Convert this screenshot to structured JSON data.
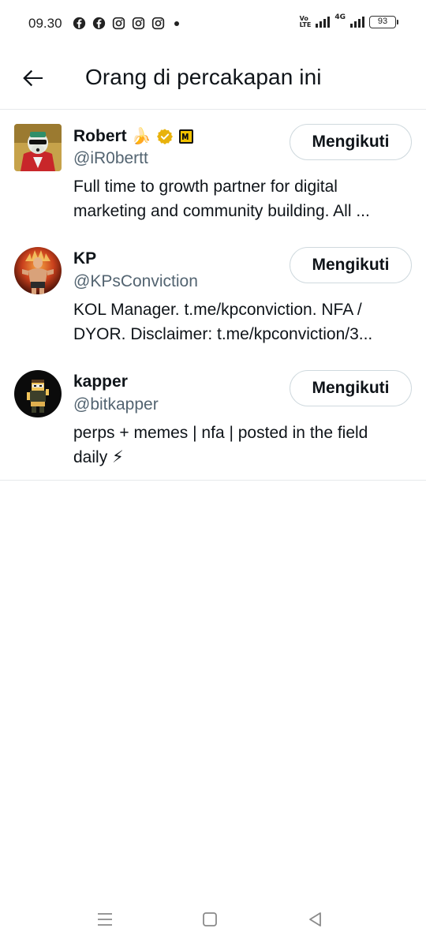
{
  "status_bar": {
    "time": "09.30",
    "notification_icons": [
      "facebook-icon",
      "facebook-icon",
      "instagram-icon",
      "instagram-icon",
      "instagram-icon"
    ],
    "volte_line1": "Vo",
    "volte_line2": "LTE",
    "network": "4G",
    "battery": "93"
  },
  "header": {
    "title": "Orang di percakapan ini"
  },
  "users": [
    {
      "name": "Robert",
      "name_emoji": "🍌",
      "verified": true,
      "affiliate_badge": true,
      "handle": "@iR0bertt",
      "bio_line1": "Full time to growth partner for digital",
      "bio_line2": "marketing and community building. All ...",
      "follow_label": "Mengikuti"
    },
    {
      "name": "KP",
      "handle": "@KPsConviction",
      "bio_line1": "KOL Manager. t.me/kpconviction. NFA /",
      "bio_line2": "DYOR. Disclaimer: t.me/kpconviction/3...",
      "follow_label": "Mengikuti"
    },
    {
      "name": "kapper",
      "handle": "@bitkapper",
      "bio_line1": "perps + memes | nfa | posted in the field",
      "bio_line2": "daily ⚡",
      "follow_label": "Mengikuti"
    }
  ],
  "colors": {
    "text_primary": "#0f1419",
    "text_secondary": "#536471",
    "divider": "#e6e9eb",
    "verified_gold": "#e8b20c"
  }
}
